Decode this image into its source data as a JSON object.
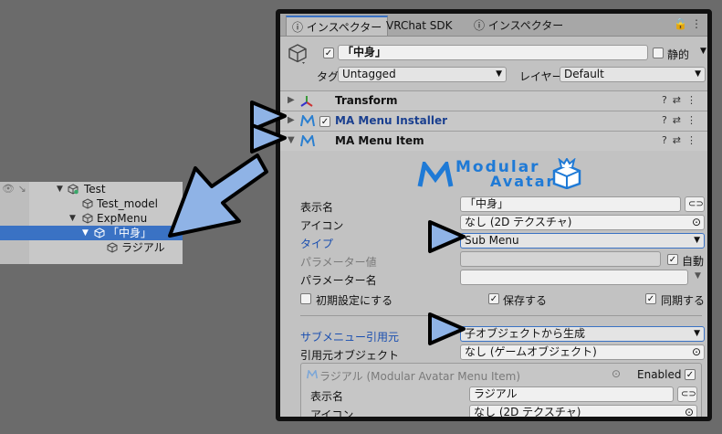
{
  "hierarchy": {
    "items": [
      {
        "label": "Test",
        "indent": 0,
        "expanded": true,
        "selected": false
      },
      {
        "label": "Test_model",
        "indent": 1,
        "expanded": false,
        "selected": false
      },
      {
        "label": "ExpMenu",
        "indent": 1,
        "expanded": true,
        "selected": false
      },
      {
        "label": "「中身」",
        "indent": 2,
        "expanded": true,
        "selected": true
      },
      {
        "label": "ラジアル",
        "indent": 3,
        "expanded": false,
        "selected": false
      }
    ]
  },
  "inspector": {
    "tabs": [
      {
        "label": "インスペクター",
        "active": true
      },
      {
        "label": "VRChat SDK",
        "active": false
      },
      {
        "label": "インスペクター",
        "active": false
      }
    ],
    "object": {
      "name": "「中身」",
      "static_label": "静的",
      "tag_label": "タグ",
      "tag_value": "Untagged",
      "layer_label": "レイヤー",
      "layer_value": "Default"
    },
    "components": {
      "transform": "Transform",
      "installer": "MA Menu Installer",
      "menu_item": "MA Menu Item"
    },
    "logo_text": {
      "line1": "Modular",
      "line2": "Avatar"
    },
    "menu_item": {
      "display_name_label": "表示名",
      "display_name_value": "「中身」",
      "icon_label": "アイコン",
      "icon_value": "なし (2D テクスチャ)",
      "type_label": "タイプ",
      "type_value": "Sub Menu",
      "param_value_label": "パラメーター値",
      "auto_label": "自動",
      "param_name_label": "パラメーター名",
      "initial_label": "初期設定にする",
      "save_label": "保存する",
      "sync_label": "同期する",
      "submenu_source_label": "サブメニュー引用元",
      "submenu_source_value": "子オブジェクトから生成",
      "source_object_label": "引用元オブジェクト",
      "source_object_value": "なし (ゲームオブジェクト)"
    },
    "nested": {
      "title": "ラジアル (Modular Avatar Menu Item)",
      "enabled_label": "Enabled",
      "display_name_label": "表示名",
      "display_name_value": "ラジアル",
      "icon_label": "アイコン",
      "icon_value": "なし (2D テクスチャ)"
    }
  },
  "colors": {
    "selection": "#3a72c4",
    "arrow_fill": "#8fb3e6",
    "arrow_stroke": "#000000",
    "blue_label": "#1a4fb0"
  }
}
